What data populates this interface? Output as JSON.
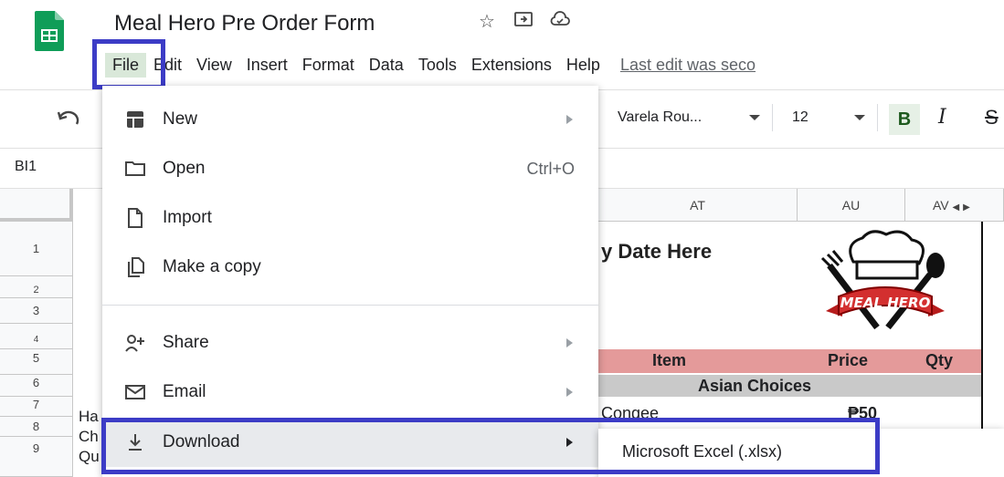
{
  "doc": {
    "title": "Meal Hero Pre Order Form",
    "title_icons": [
      "star-icon",
      "move-to-folder-icon",
      "cloud-status-icon"
    ]
  },
  "menubar": {
    "items": [
      "File",
      "Edit",
      "View",
      "Insert",
      "Format",
      "Data",
      "Tools",
      "Extensions",
      "Help"
    ],
    "last_edit": "Last edit was seco"
  },
  "toolbar": {
    "font": "Varela Rou...",
    "size": "12",
    "bold": "B",
    "italic": "I",
    "strike": "S"
  },
  "name_box": "BI1",
  "columns": [
    "AT",
    "AU",
    "AV"
  ],
  "rows": [
    "1",
    "2",
    "3",
    "4",
    "5",
    "6",
    "7",
    "8",
    "9"
  ],
  "sheet": {
    "date_placeholder": "y Date Here",
    "header_item": "Item",
    "header_price": "Price",
    "header_qty": "Qty",
    "section": "Asian Choices",
    "row7_item": "Congee",
    "row7_price": "₱50",
    "left_col": [
      "Ha",
      "Ch",
      "Qu"
    ]
  },
  "file_menu": {
    "items": [
      {
        "label": "New",
        "icon": "sheets-new-icon",
        "submenu": true
      },
      {
        "label": "Open",
        "icon": "folder-icon",
        "shortcut": "Ctrl+O"
      },
      {
        "label": "Import",
        "icon": "file-icon"
      },
      {
        "label": "Make a copy",
        "icon": "copy-icon"
      },
      {
        "label": "Share",
        "icon": "person-add-icon",
        "submenu": true
      },
      {
        "label": "Email",
        "icon": "mail-icon",
        "submenu": true
      },
      {
        "label": "Download",
        "icon": "download-icon",
        "submenu": true
      }
    ]
  },
  "download_submenu": {
    "items": [
      "Microsoft Excel (.xlsx)"
    ]
  },
  "colors": {
    "highlight": "#3c3cc6",
    "pink_header": "#e49a9a",
    "section_gray": "#c9c9c9",
    "sheets_green": "#0f9d58"
  }
}
